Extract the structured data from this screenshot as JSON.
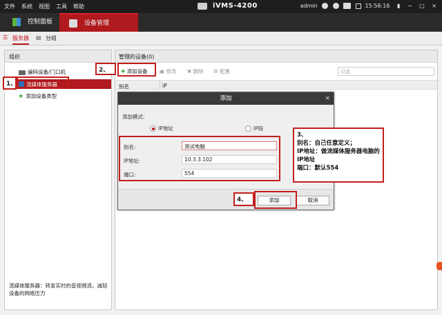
{
  "menu": [
    "文件",
    "系统",
    "视图",
    "工具",
    "帮助"
  ],
  "app_title": "iVMS-4200",
  "status": {
    "user": "admin",
    "time": "15:56:16"
  },
  "main_tabs": [
    {
      "label": "控制面板"
    },
    {
      "label": "设备管理"
    }
  ],
  "sub_tabs": [
    {
      "label": "服务器"
    },
    {
      "label": "分组"
    }
  ],
  "left_panel": {
    "header": "组织",
    "items": [
      {
        "label": "编码设备/门口机"
      },
      {
        "label": "流媒体服务器"
      },
      {
        "label": "添加设备类型"
      }
    ],
    "footer": "流媒体服务器：转发实时的音视频流，减轻设备的网络压力"
  },
  "right_panel": {
    "header": "管理的设备(0)",
    "toolbar": {
      "add": "添加设备",
      "edit": "修改",
      "delete": "删除",
      "config": "配置",
      "filter_placeholder": "过滤"
    },
    "columns": [
      "别名",
      "IP"
    ]
  },
  "dialog": {
    "title": "添加",
    "close": "×",
    "mode_label": "添加模式:",
    "mode_options": [
      "IP地址",
      "IP段"
    ],
    "fields": [
      {
        "label": "别名:",
        "value": "测试电脑"
      },
      {
        "label": "IP地址:",
        "value": "10.3.3.102"
      },
      {
        "label": "端口:",
        "value": "554"
      }
    ],
    "add_button": "添加",
    "cancel_button": "取消"
  },
  "callouts": {
    "step1": "1、",
    "step2": "2、",
    "step4": "4、",
    "note_lines": [
      "3、",
      "别名：自己任意定义；",
      "IP地址：做流媒体服务器电脑的IP地址",
      "端口：默认554"
    ]
  },
  "colors": {
    "accent": "#b0191d",
    "callout": "#c21d1d",
    "titlebar": "#1e1e1e"
  }
}
